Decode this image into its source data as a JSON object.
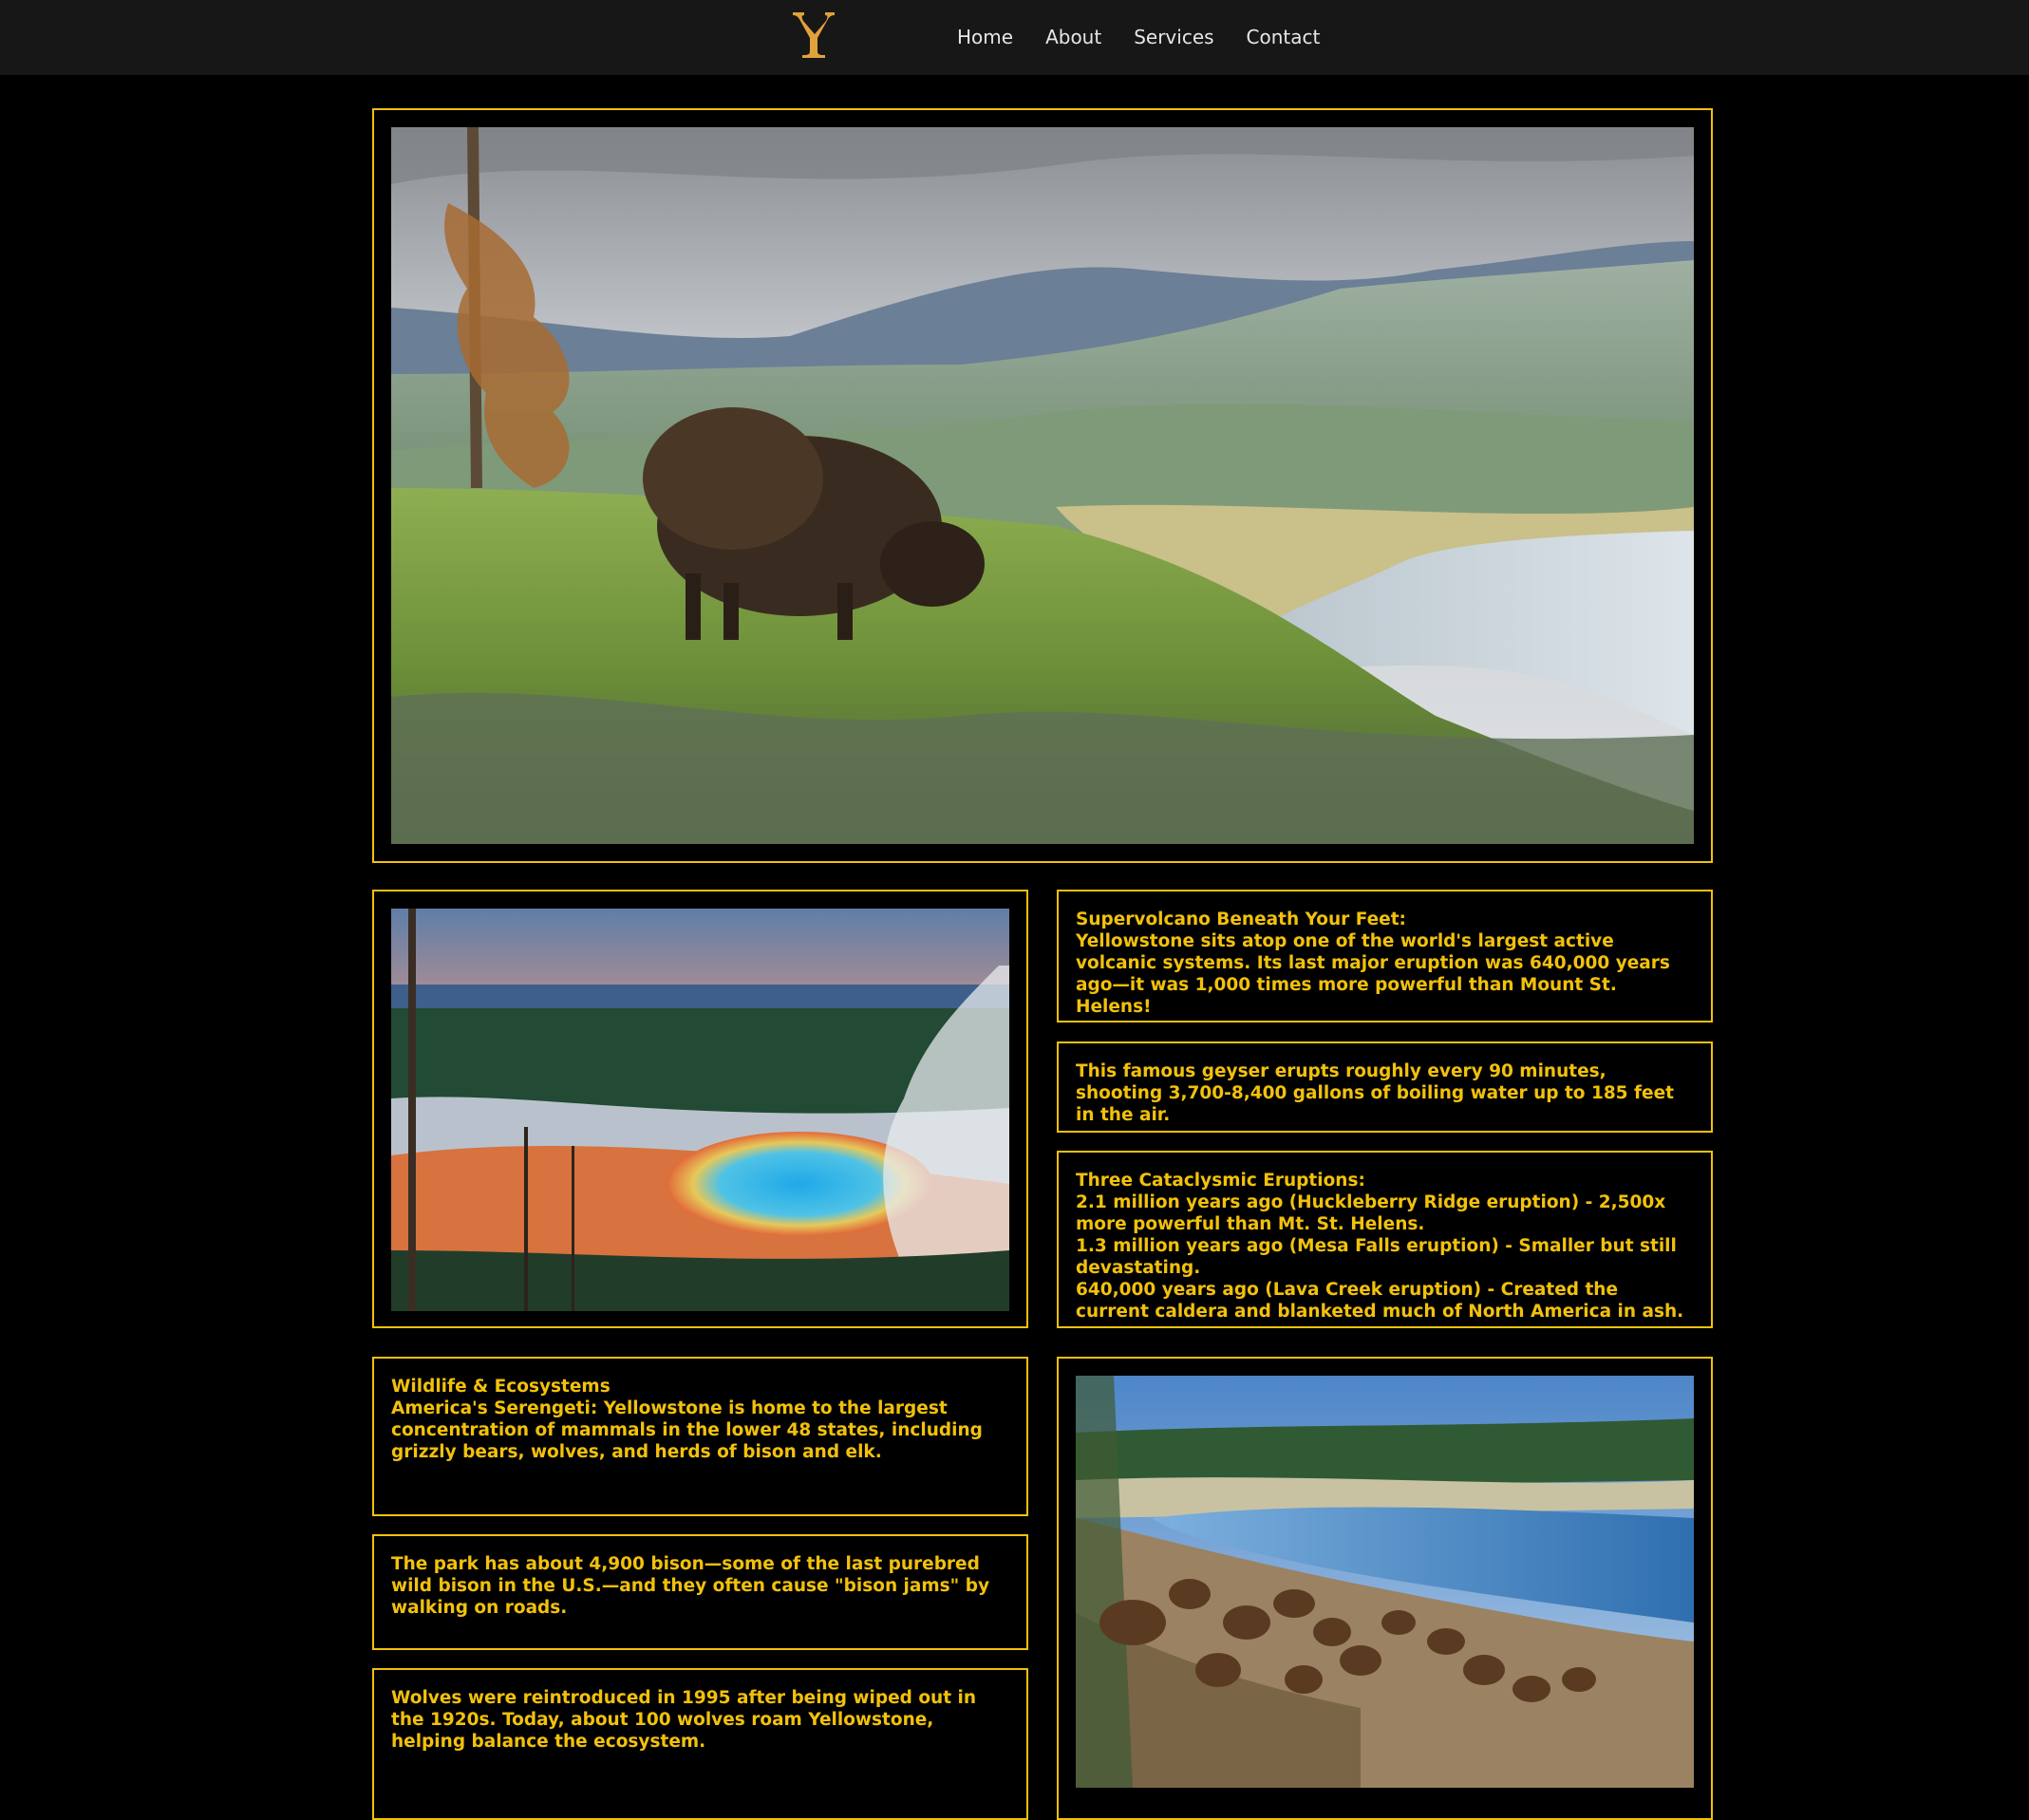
{
  "colors": {
    "accent": "#f2c10b",
    "nav_background": "#171717",
    "page_background": "#000000",
    "nav_text": "#e6e6e6",
    "logo": "#e0a23a"
  },
  "nav": {
    "logo_icon": "yellowstone-y-brand-icon",
    "links": [
      "Home",
      "About",
      "Services",
      "Contact"
    ]
  },
  "hero": {
    "image_alt": "bison-grazing-valley-photo"
  },
  "photos": {
    "prismatic": "grand-prismatic-spring-photo",
    "bison_herd": "bison-herd-river-photo"
  },
  "cards": {
    "supervolcano": {
      "heading": "Supervolcano Beneath Your Feet:",
      "body": "Yellowstone sits atop one of the world's largest active volcanic systems. Its last major eruption was 640,000 years ago—it was 1,000 times more powerful than Mount St. Helens!"
    },
    "geyser": {
      "body": "This famous geyser erupts roughly every 90 minutes, shooting 3,700-8,400 gallons of boiling water up to 185 feet in the air."
    },
    "eruptions": {
      "heading": "Three Cataclysmic Eruptions:",
      "lines": [
        "2.1 million years ago (Huckleberry Ridge eruption) - 2,500x more powerful than Mt. St. Helens.",
        "1.3 million years ago (Mesa Falls eruption) - Smaller but still devastating.",
        "640,000 years ago (Lava Creek eruption) - Created the current caldera and blanketed much of North America in ash."
      ]
    },
    "wildlife": {
      "heading": "Wildlife & Ecosystems",
      "body": "America's Serengeti: Yellowstone is home to the largest concentration of mammals in the lower 48 states, including grizzly bears, wolves, and herds of bison and elk."
    },
    "bison": {
      "body": "The park has about 4,900 bison—some of the last purebred wild bison in the U.S.—and they often cause \"bison jams\" by walking on roads."
    },
    "wolves": {
      "body": "Wolves were reintroduced in 1995 after being wiped out in the 1920s. Today, about 100 wolves roam Yellowstone, helping balance the ecosystem."
    }
  }
}
